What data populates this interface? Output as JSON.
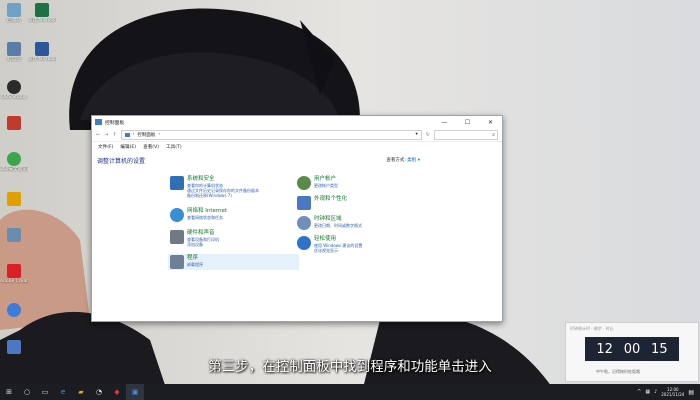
{
  "desktop": {
    "icons": [
      {
        "label": "回收站",
        "color": "#6fa0c8"
      },
      {
        "label": "新建 Microsoft…",
        "color": "#1e7145"
      },
      {
        "label": "此电脑",
        "color": "#5a7ea8"
      },
      {
        "label": "新建 Microsoft…",
        "color": "#2b579a"
      },
      {
        "label": "OBS Studio",
        "color": "#2b2b2b"
      },
      {
        "label": "",
        "color": "#c0392b"
      },
      {
        "label": "360安全浏览器",
        "color": "#3aa64a"
      },
      {
        "label": "",
        "color": "#e0a000"
      },
      {
        "label": "",
        "color": "#6c8bb0"
      },
      {
        "label": "Adobe Creati…",
        "color": "#da1f26"
      },
      {
        "label": "",
        "color": "#3b7dd8"
      },
      {
        "label": "",
        "color": "#4a78c2"
      }
    ]
  },
  "window": {
    "title": "控制面板",
    "minimize": "—",
    "maximize": "☐",
    "close": "✕",
    "address_path": "控制面板",
    "menu": [
      "文件(F)",
      "编辑(E)",
      "查看(V)",
      "工具(T)"
    ],
    "heading": "调整计算机的设置",
    "view_by_label": "查看方式:",
    "view_by_value": "类别 ▾",
    "categories_left": [
      {
        "title": "系统和安全",
        "color": "#2f6fb5",
        "links": [
          "查看你的计算机状态",
          "通过文件历史记录保存你的文件备份副本",
          "备份和还原(Windows 7)"
        ]
      },
      {
        "title": "网络和 Internet",
        "color": "#3a8fd4",
        "links": [
          "查看网络状态和任务"
        ]
      },
      {
        "title": "硬件和声音",
        "color": "#707a86",
        "links": [
          "查看设备和打印机",
          "添加设备"
        ]
      },
      {
        "title": "程序",
        "color": "#6d7f99",
        "links": [
          "卸载程序"
        ]
      }
    ],
    "categories_right": [
      {
        "title": "用户帐户",
        "color": "#5a8a4a",
        "links": [
          "更改帐户类型"
        ]
      },
      {
        "title": "外观和个性化",
        "color": "#4a78c2",
        "links": []
      },
      {
        "title": "时钟和区域",
        "color": "#6f8fb8",
        "links": [
          "更改日期、时间或数字格式"
        ]
      },
      {
        "title": "轻松使用",
        "color": "#2f73c8",
        "links": [
          "使用 Windows 建议的设置",
          "优化视觉显示"
        ]
      }
    ]
  },
  "subtitle": "第三步，在控制面板中找到程序和功能单击进入",
  "clock_widget": {
    "header": "时钟倒计时 · 剩余 · 时长",
    "hours": "12",
    "minutes": "00",
    "seconds": "15",
    "footer": "中午啦，记得按时吃饭哦"
  },
  "taskbar": {
    "time": "12:00",
    "date": "2021/11/24"
  }
}
